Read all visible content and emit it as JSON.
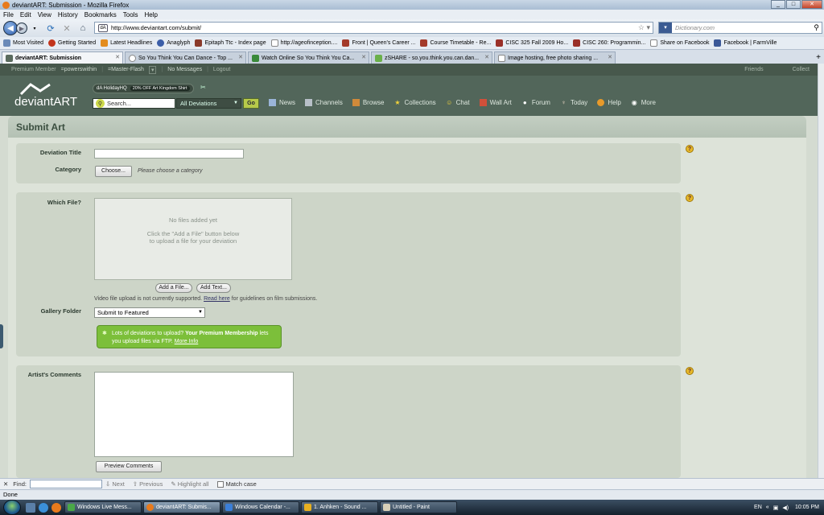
{
  "window": {
    "title": "deviantART: Submission - Mozilla Firefox"
  },
  "menu": [
    "File",
    "Edit",
    "View",
    "History",
    "Bookmarks",
    "Tools",
    "Help"
  ],
  "nav": {
    "url": "http://www.deviantart.com/submit/",
    "search_placeholder": "Dictionary.com"
  },
  "bookmarks": [
    "Most Visited",
    "Getting Started",
    "Latest Headlines",
    "Anaglyph",
    "Epitaph Ttc - Index page",
    "http://ageofinception....",
    "Front | Queen's Career ...",
    "Course Timetable - Re...",
    "CISC 325 Fall 2009 Ho...",
    "CISC 260: Programmin...",
    "Share on Facebook",
    "Facebook | FarmVille"
  ],
  "tabs": [
    {
      "label": "deviantART: Submission",
      "active": true
    },
    {
      "label": "So You Think You Can Dance - Top ...",
      "active": false
    },
    {
      "label": "Watch Online So You Think You Ca...",
      "active": false
    },
    {
      "label": "zSHARE - so.you.think.you.can.dan...",
      "active": false
    },
    {
      "label": "Image hosting, free photo sharing ...",
      "active": false
    }
  ],
  "da_topbar": {
    "member": "Premium Member",
    "user": "=powerswithin",
    "group": "=Master-Flash",
    "messages": "No Messages",
    "logout": "Logout",
    "friends": "Friends",
    "collect": "Collect"
  },
  "da_header": {
    "logo": "deviantART",
    "promo": "dA HolidayHQ",
    "promo_off": "20% OFF Art Kingdom Shirt",
    "search_placeholder": "Search...",
    "scope": "All Deviations",
    "go": "Go",
    "nav_items": [
      "News",
      "Channels",
      "Browse",
      "Collections",
      "Chat",
      "Wall Art",
      "Forum",
      "Today",
      "Help",
      "More"
    ]
  },
  "form": {
    "page_title": "Submit Art",
    "title_label": "Deviation Title",
    "category_label": "Category",
    "choose_button": "Choose...",
    "category_hint": "Please choose a category",
    "file_label": "Which File?",
    "no_files": "No files added yet",
    "drop_hint_1": "Click the \"Add a File\" button below",
    "drop_hint_2": "to upload a file for your deviation",
    "add_file_button": "Add a File...",
    "add_text_button": "Add Text...",
    "video_note_pre": "Video file upload is not currently supported.",
    "video_note_link": "Read here",
    "video_note_post": "for guidelines on film submissions.",
    "gallery_label": "Gallery Folder",
    "gallery_value": "Submit to Featured",
    "premium_1": "Lots of deviations to upload?",
    "premium_bold": "Your Premium Membership",
    "premium_2": "lets you upload files via FTP.",
    "premium_link": "More Info",
    "comments_label": "Artist's Comments",
    "preview_button": "Preview Comments",
    "help": "?"
  },
  "findbar": {
    "label": "Find:",
    "next": "Next",
    "previous": "Previous",
    "highlight": "Highlight all",
    "match_case": "Match case"
  },
  "status": "Done",
  "taskbar": {
    "items": [
      "Windows Live Mess...",
      "deviantART: Submis...",
      "Windows Calendar -...",
      "1. Anhken - Sound ...",
      "Untitled - Paint"
    ],
    "lang": "EN",
    "time": "10:05 PM"
  }
}
